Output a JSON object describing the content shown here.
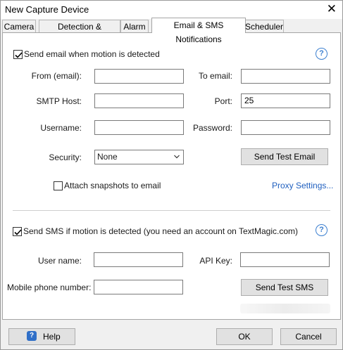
{
  "window": {
    "title": "New Capture Device",
    "close_glyph": "✕"
  },
  "tabs": [
    {
      "label": "Camera"
    },
    {
      "label": "Detection & Recording"
    },
    {
      "label": "Alarm"
    },
    {
      "label": "Email & SMS Notifications"
    },
    {
      "label": "Scheduler"
    }
  ],
  "email": {
    "enable_label": "Send email when motion is detected",
    "enabled": true,
    "from_label": "From (email):",
    "from_value": "",
    "to_label": "To email:",
    "to_value": "",
    "smtp_label": "SMTP Host:",
    "smtp_value": "",
    "port_label": "Port:",
    "port_value": "25",
    "username_label": "Username:",
    "username_value": "",
    "password_label": "Password:",
    "password_value": "",
    "security_label": "Security:",
    "security_value": "None",
    "send_test_label": "Send Test Email",
    "attach_label": "Attach snapshots to email",
    "attach_checked": false,
    "proxy_label": "Proxy Settings..."
  },
  "sms": {
    "enable_label": "Send SMS if motion is detected (you need an account on TextMagic.com)",
    "enabled": true,
    "username_label": "User name:",
    "username_value": "",
    "apikey_label": "API Key:",
    "apikey_value": "",
    "mobile_label": "Mobile phone number:",
    "mobile_value": "",
    "send_test_label": "Send Test SMS"
  },
  "footer": {
    "help_label": "Help",
    "ok_label": "OK",
    "cancel_label": "Cancel"
  },
  "icons": {
    "help": "question-mark-circle-icon",
    "checkbox": "check-icon",
    "dropdown": "chevron-down-icon"
  },
  "help_glyph": "?",
  "colors": {
    "link": "#1f5fbf",
    "help_icon": "#3b7fd0",
    "help_button_icon": "#2f6fc8"
  }
}
